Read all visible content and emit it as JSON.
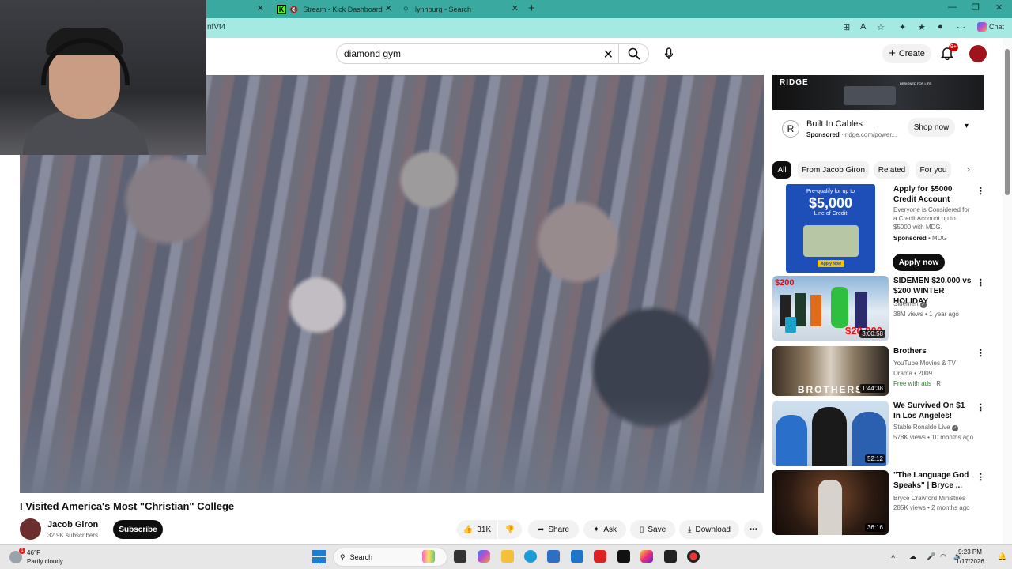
{
  "browser": {
    "tabs": [
      {
        "label": "",
        "favicon": "youtube-icon"
      },
      {
        "label": "Stream - Kick Dashboard",
        "favicon": "kick-icon"
      },
      {
        "label": "lynhburg - Search",
        "favicon": "search-icon"
      }
    ],
    "url": "nfVt4",
    "chat_label": "Chat"
  },
  "youtube": {
    "search": {
      "value": "diamond gym"
    },
    "create_label": "Create",
    "notifications_badge": "9+"
  },
  "video": {
    "title": "I Visited America's Most \"Christian\" College",
    "channel": "Jacob Giron",
    "subscribers": "32.9K subscribers",
    "subscribe_label": "Subscribe",
    "likes": "31K",
    "share_label": "Share",
    "ask_label": "Ask",
    "save_label": "Save",
    "download_label": "Download"
  },
  "sidebar": {
    "ad": {
      "banner_brand": "RIDGE",
      "banner_tagline": "DESIGNED FOR LIFE.",
      "title": "Built In Cables",
      "sponsored": "Sponsored",
      "domain": "ridge.com/power...",
      "cta": "Shop now",
      "logo_letter": "R"
    },
    "chips": [
      "All",
      "From Jacob Giron",
      "Related",
      "For you"
    ],
    "items": [
      {
        "title": "Apply for $5000 Credit Account",
        "line1": "Everyone is Considered for a Credit Account up to $5000 with MDG.",
        "sponsored": "Sponsored",
        "advertiser": "MDG",
        "cta": "Apply now",
        "thumb_heading": "Pre-qualify for up to",
        "thumb_amount": "$5,000",
        "thumb_sub": "Line of Credit",
        "thumb_btn": "Apply Now"
      },
      {
        "title": "SIDEMEN $20,000 vs $200 WINTER HOLIDAY",
        "channel": "Sidemen",
        "meta": "38M views • 1 year ago",
        "duration": "3:00:58",
        "thumb_price_low": "$200",
        "thumb_price_high": "$20,000"
      },
      {
        "title": "Brothers",
        "channel": "YouTube Movies & TV",
        "meta": "Drama • 2009",
        "badge": "Free with ads",
        "rating": "R",
        "duration": "1:44:38",
        "thumb_text": "BROTHERS"
      },
      {
        "title": "We Survived On $1 In Los Angeles!",
        "channel": "Stable Ronaldo Live",
        "meta": "578K views • 10 months ago",
        "duration": "52:12"
      },
      {
        "title": "\"The Language God Speaks\" | Bryce ...",
        "channel": "Bryce Crawford Ministries",
        "meta": "285K views • 2 months ago",
        "duration": "36:16"
      }
    ]
  },
  "taskbar": {
    "weather_temp": "46°F",
    "weather_cond": "Partly cloudy",
    "search_label": "Search",
    "time": "9:23 PM",
    "date": "1/17/2026"
  }
}
